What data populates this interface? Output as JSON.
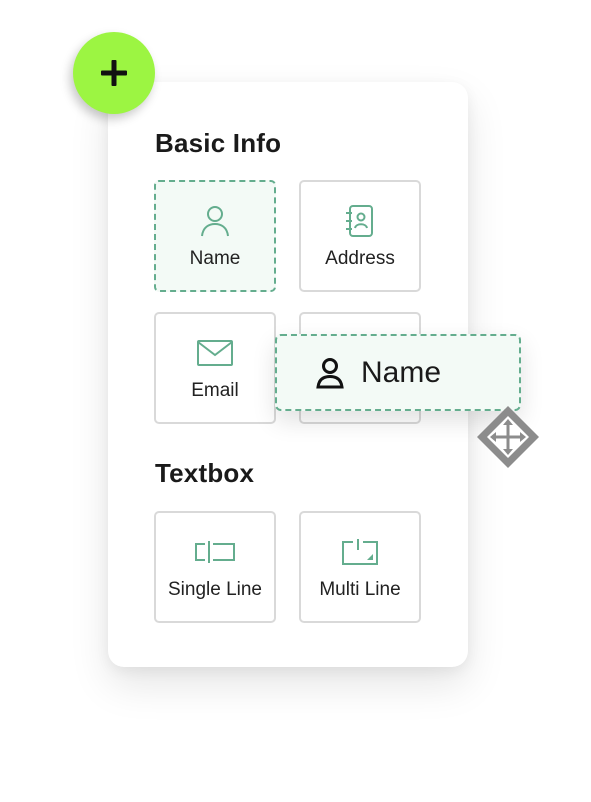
{
  "panel": {
    "add_button": {
      "icon": "plus-icon",
      "color": "#9cf542"
    },
    "sections": [
      {
        "title": "Basic Info",
        "fields": [
          {
            "label": "Name",
            "icon": "person-icon",
            "selected": true
          },
          {
            "label": "Address",
            "icon": "address-book-icon",
            "selected": false
          },
          {
            "label": "Email",
            "icon": "envelope-icon",
            "selected": false
          },
          {
            "label": "",
            "icon": "",
            "selected": false
          }
        ]
      },
      {
        "title": "Textbox",
        "fields": [
          {
            "label": "Single Line",
            "icon": "single-line-icon",
            "selected": false
          },
          {
            "label": "Multi Line",
            "icon": "multi-line-icon",
            "selected": false
          }
        ]
      }
    ]
  },
  "drag_chip": {
    "label": "Name",
    "icon": "person-icon"
  },
  "colors": {
    "accent_green": "#64ad8e",
    "selected_bg": "#f3faf6",
    "card_border": "#d9d9d9",
    "move_handle": "#8c8c8c"
  }
}
